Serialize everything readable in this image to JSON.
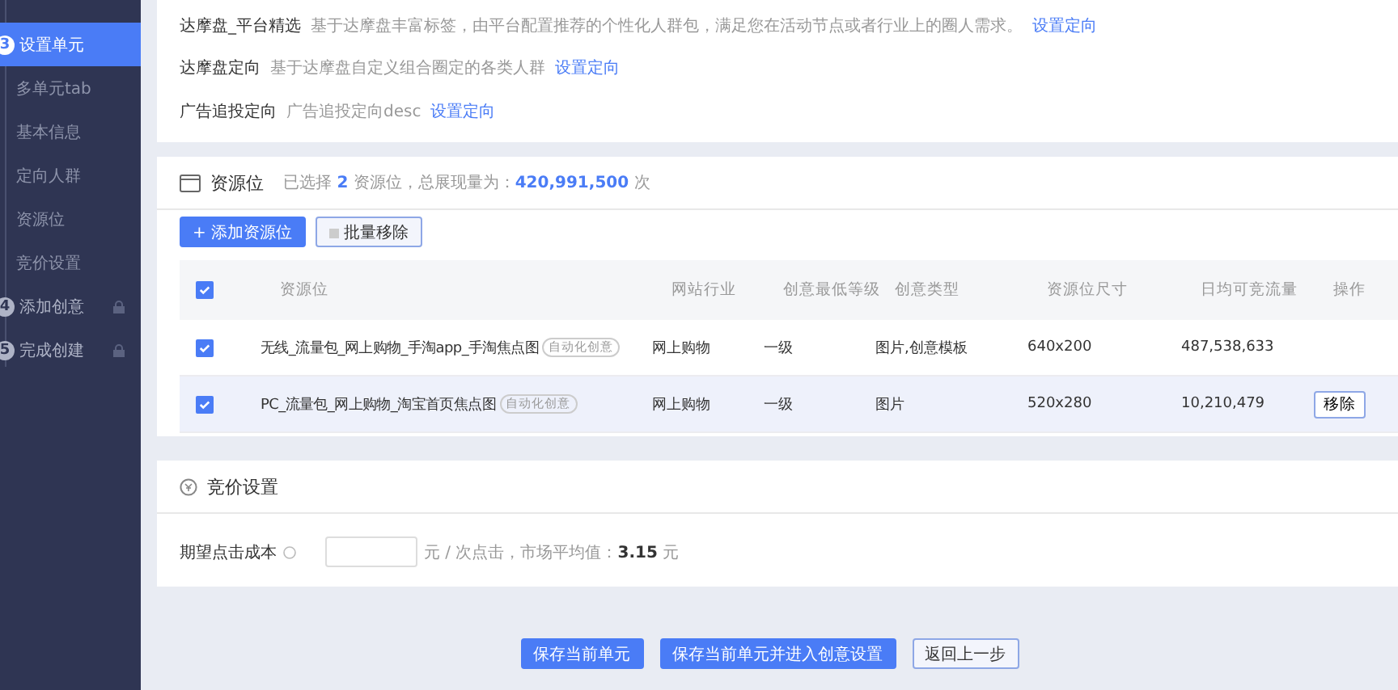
{
  "sidebar": {
    "steps": [
      {
        "number": "3",
        "label": "设置单元",
        "selected": true,
        "locked": false,
        "children": [
          {
            "label": "多单元tab"
          },
          {
            "label": "基本信息"
          },
          {
            "label": "定向人群"
          },
          {
            "label": "资源位"
          },
          {
            "label": "竞价设置"
          }
        ]
      },
      {
        "number": "4",
        "label": "添加创意",
        "selected": false,
        "locked": true
      },
      {
        "number": "5",
        "label": "完成创建",
        "selected": false,
        "locked": true
      }
    ]
  },
  "targeting": [
    {
      "title": "达摩盘_平台精选",
      "desc": "基于达摩盘丰富标签，由平台配置推荐的个性化人群包，满足您在活动节点或者行业上的圈人需求。",
      "link": "设置定向"
    },
    {
      "title": "达摩盘定向",
      "desc": "基于达摩盘自定义组合圈定的各类人群",
      "link": "设置定向"
    },
    {
      "title": "广告追投定向",
      "desc": "广告追投定向desc",
      "link": "设置定向"
    }
  ],
  "resources": {
    "title": "资源位",
    "summary": "已选择 **2** 资源位，总展现量为：**420,991,500** 次",
    "add_button": "+ 添加资源位",
    "remove_button": "批量移除",
    "columns": [
      "资源位",
      "网站行业",
      "创意最低等级",
      "创意类型",
      "资源位尺寸",
      "日均可竞流量",
      "操作"
    ],
    "all_checked": true,
    "rows": [
      {
        "checked": true,
        "selected": false,
        "name": "无线_流量包_网上购物_手淘app_手淘焦点图",
        "tag": "自动化创意",
        "industry": "网上购物",
        "level": "一级",
        "type": "图片,创意模板",
        "size": "640x200",
        "traffic": "487,538,633"
      },
      {
        "checked": true,
        "selected": true,
        "name": "PC_流量包_网上购物_淘宝首页焦点图",
        "tag": "自动化创意",
        "industry": "网上购物",
        "level": "一级",
        "type": "图片",
        "size": "520x280",
        "traffic": "10,210,479",
        "action": "移除"
      }
    ]
  },
  "bid": {
    "title": "竞价设置",
    "label": "期望点击成本",
    "suffix": "元 / 次点击，市场平均值：**3.15** 元"
  },
  "buttons": [
    {
      "label": "保存当前单元",
      "primary": true
    },
    {
      "label": "保存当前单元并进入创意设置",
      "primary": true
    },
    {
      "label": "返回上一步",
      "primary": false
    }
  ]
}
